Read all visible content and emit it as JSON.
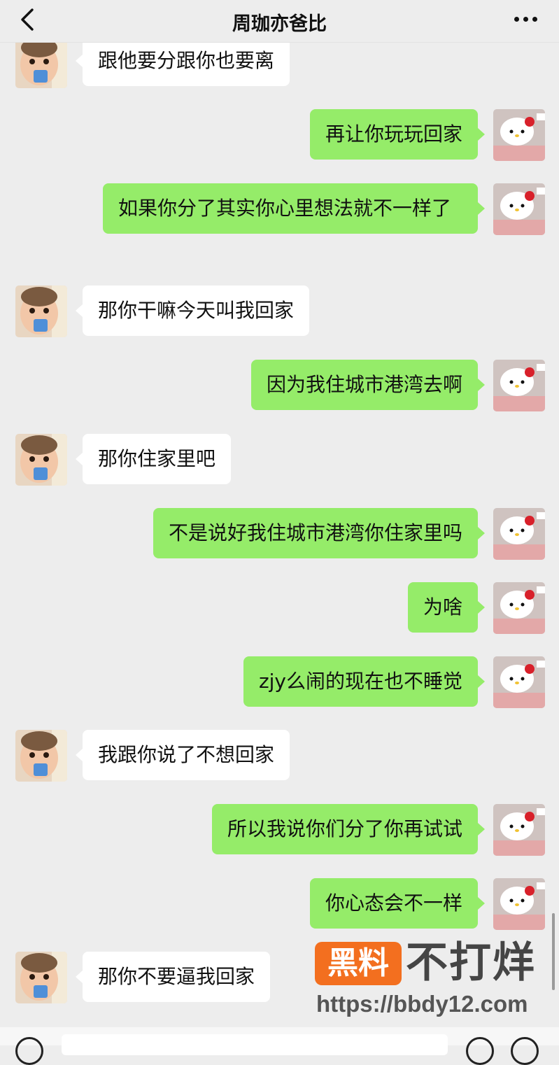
{
  "header": {
    "title": "周珈亦爸比"
  },
  "messages": [
    {
      "side": "left",
      "text": "跟他要分跟你也要离"
    },
    {
      "side": "right",
      "text": "再让你玩玩回家"
    },
    {
      "side": "right",
      "text": "如果你分了其实你心里想法就不一样了"
    },
    {
      "side": "left",
      "text": "那你干嘛今天叫我回家"
    },
    {
      "side": "right",
      "text": "因为我住城市港湾去啊"
    },
    {
      "side": "left",
      "text": "那你住家里吧"
    },
    {
      "side": "right",
      "text": "不是说好我住城市港湾你住家里吗"
    },
    {
      "side": "right",
      "text": "为啥"
    },
    {
      "side": "right",
      "text": "zjy么闹的现在也不睡觉"
    },
    {
      "side": "left",
      "text": "我跟你说了不想回家"
    },
    {
      "side": "right",
      "text": "所以我说你们分了你再试试"
    },
    {
      "side": "right",
      "text": "你心态会不一样"
    },
    {
      "side": "left",
      "text": "那你不要逼我回家"
    }
  ],
  "watermark": {
    "badge": "黑料",
    "text": "不打烊",
    "url": "https://bbdy12.com"
  },
  "colors": {
    "sent_bubble": "#95ec69",
    "received_bubble": "#ffffff",
    "background": "#ededed",
    "watermark_badge": "#f36f1f"
  },
  "icons": {
    "back": "chevron-left-icon",
    "more": "more-dots-icon",
    "sender_avatar": "hello-kitty-avatar",
    "receiver_avatar": "baby-avatar"
  }
}
